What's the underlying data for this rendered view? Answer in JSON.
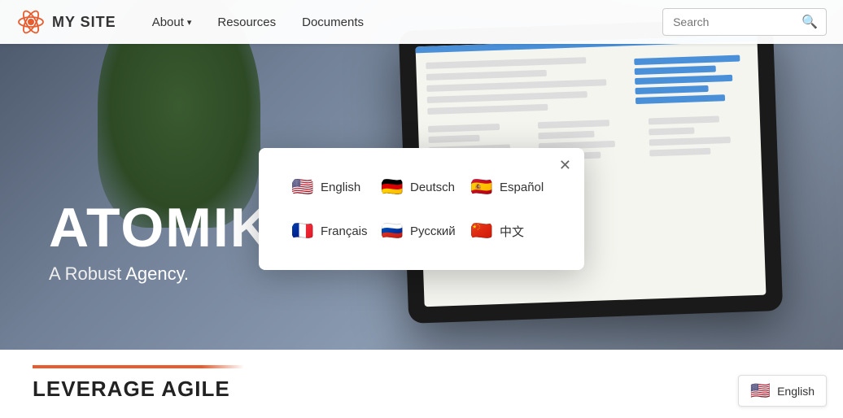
{
  "nav": {
    "logo_text": "MY SITE",
    "links": [
      {
        "label": "About",
        "has_dropdown": true
      },
      {
        "label": "Resources",
        "has_dropdown": false
      },
      {
        "label": "Documents",
        "has_dropdown": false
      }
    ],
    "search_placeholder": "Search",
    "search_icon": "🔍"
  },
  "hero": {
    "title": "ATOMIK AGENCY",
    "subtitle": "A Robust Agency."
  },
  "bottom": {
    "title": "LEVERAGE AGILE"
  },
  "modal": {
    "languages": [
      {
        "code": "en",
        "label": "English",
        "flag": "🇺🇸"
      },
      {
        "code": "de",
        "label": "Deutsch",
        "flag": "🇩🇪"
      },
      {
        "code": "es",
        "label": "Español",
        "flag": "🇪🇸"
      },
      {
        "code": "fr",
        "label": "Français",
        "flag": "🇫🇷"
      },
      {
        "code": "ru",
        "label": "Русский",
        "flag": "🇷🇺"
      },
      {
        "code": "zh",
        "label": "中文",
        "flag": "🇨🇳"
      }
    ],
    "close_label": "✕"
  },
  "english_button": {
    "flag": "🇺🇸",
    "label": "English"
  }
}
